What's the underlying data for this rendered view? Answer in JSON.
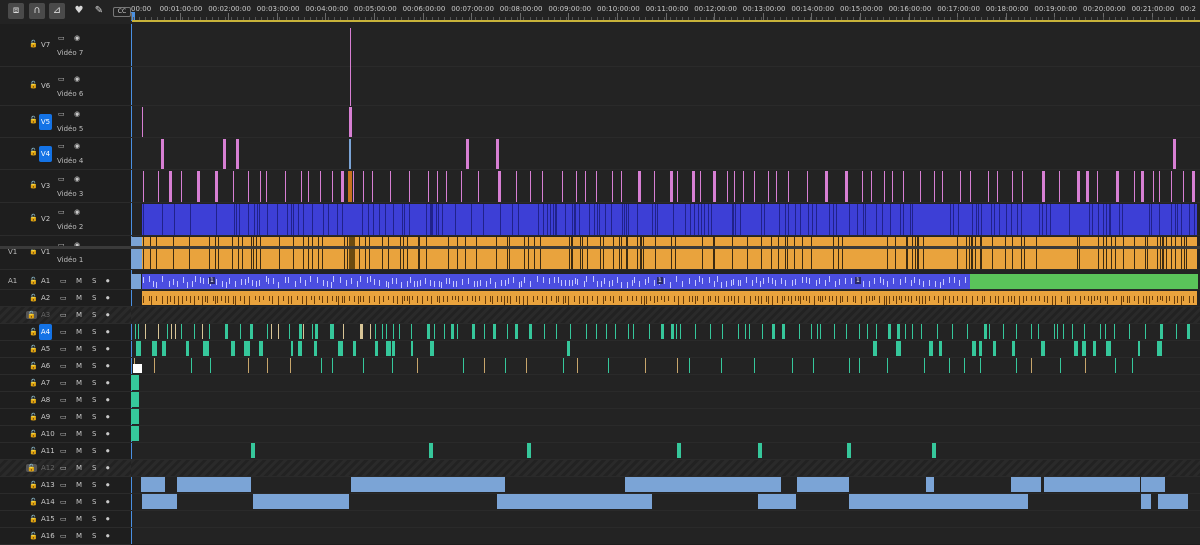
{
  "toolbar": {
    "icons": [
      {
        "name": "nest-sequence-icon",
        "glyph": "⧈"
      },
      {
        "name": "snap-magnet-icon",
        "glyph": "∩"
      },
      {
        "name": "linked-selection-icon",
        "glyph": "⊿"
      },
      {
        "name": "add-marker-icon",
        "glyph": "♥"
      },
      {
        "name": "wrench-settings-icon",
        "glyph": "✎"
      },
      {
        "name": "captions-icon",
        "glyph": "CC"
      }
    ]
  },
  "ruler": {
    "timecodes": [
      "00:00",
      "00:01:00:00",
      "00:02:00:00",
      "00:03:00:00",
      "00:04:00:00",
      "00:05:00:00",
      "00:06:00:00",
      "00:07:00:00",
      "00:08:00:00",
      "00:09:00:00",
      "00:10:00:00",
      "00:11:00:00",
      "00:12:00:00",
      "00:13:00:00",
      "00:14:00:00",
      "00:15:00:00",
      "00:16:00:00",
      "00:17:00:00",
      "00:18:00:00",
      "00:19:00:00",
      "00:20:00:00",
      "00:21:00:00",
      "00:2"
    ]
  },
  "video_tracks": [
    {
      "id": "V7",
      "title": "Vidéo 7",
      "selected": false,
      "source": ""
    },
    {
      "id": "V6",
      "title": "Vidéo 6",
      "selected": false,
      "source": ""
    },
    {
      "id": "V5",
      "title": "Vidéo 5",
      "selected": true,
      "source": ""
    },
    {
      "id": "V4",
      "title": "Vidéo 4",
      "selected": true,
      "source": ""
    },
    {
      "id": "V3",
      "title": "Vidéo 3",
      "selected": false,
      "source": ""
    },
    {
      "id": "V2",
      "title": "Vidéo 2",
      "selected": false,
      "source": ""
    },
    {
      "id": "V1",
      "title": "Vidéo 1",
      "selected": false,
      "source": "V1"
    }
  ],
  "audio_tracks": [
    {
      "id": "A1",
      "source": "A1",
      "selected": false,
      "locked": false
    },
    {
      "id": "A2",
      "source": "",
      "selected": false,
      "locked": false
    },
    {
      "id": "A3",
      "source": "",
      "selected": false,
      "locked": true
    },
    {
      "id": "A4",
      "source": "",
      "selected": true,
      "locked": false
    },
    {
      "id": "A5",
      "source": "",
      "selected": false,
      "locked": false
    },
    {
      "id": "A6",
      "source": "",
      "selected": false,
      "locked": false
    },
    {
      "id": "A7",
      "source": "",
      "selected": false,
      "locked": false
    },
    {
      "id": "A8",
      "source": "",
      "selected": false,
      "locked": false
    },
    {
      "id": "A9",
      "source": "",
      "selected": false,
      "locked": false
    },
    {
      "id": "A10",
      "source": "",
      "selected": false,
      "locked": false
    },
    {
      "id": "A11",
      "source": "",
      "selected": false,
      "locked": false
    },
    {
      "id": "A12",
      "source": "",
      "selected": false,
      "locked": true
    },
    {
      "id": "A13",
      "source": "",
      "selected": false,
      "locked": false
    },
    {
      "id": "A14",
      "source": "",
      "selected": false,
      "locked": false
    },
    {
      "id": "A15",
      "source": "",
      "selected": false,
      "locked": false
    },
    {
      "id": "A16",
      "source": "",
      "selected": false,
      "locked": false
    }
  ],
  "audio_buttons": {
    "mute": "M",
    "solo": "S"
  },
  "clip_markers": [
    "1",
    "1",
    "1"
  ],
  "colors": {
    "playhead": "#4a90e2",
    "selected_track": "#1473e6",
    "pink_clip": "#d77fd3",
    "violet_clip": "#3d3fd6",
    "orange_clip": "#e9a33d",
    "green_clip": "#5ac35a",
    "teal_clip": "#36c79b",
    "light_blue_clip": "#7ba4d6",
    "work_area": "#c8b33a"
  }
}
